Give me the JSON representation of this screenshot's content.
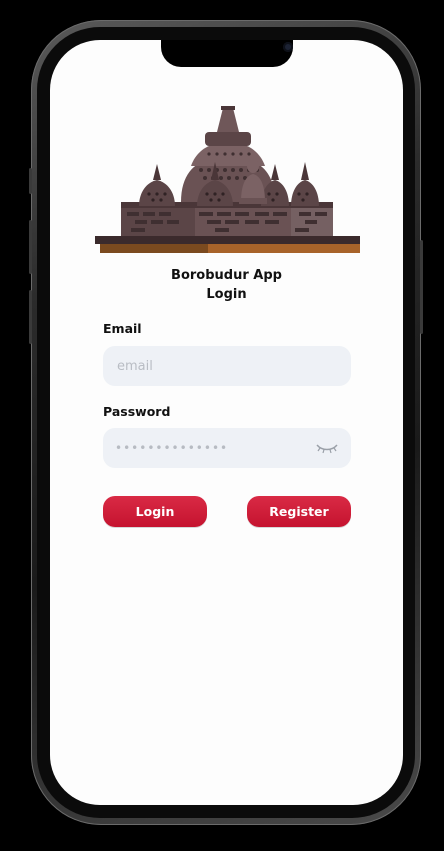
{
  "app": {
    "title_line1": "Borobudur App",
    "title_line2": "Login"
  },
  "form": {
    "email_label": "Email",
    "email_placeholder": "email",
    "email_value": "",
    "password_label": "Password",
    "password_masked": "••••••••••••••",
    "password_toggle_icon": "eye-closed-icon"
  },
  "actions": {
    "login_label": "Login",
    "register_label": "Register"
  },
  "colors": {
    "accent": "#c8162f",
    "input_bg": "#eef1f6",
    "screen_bg": "#fdfdfd"
  }
}
